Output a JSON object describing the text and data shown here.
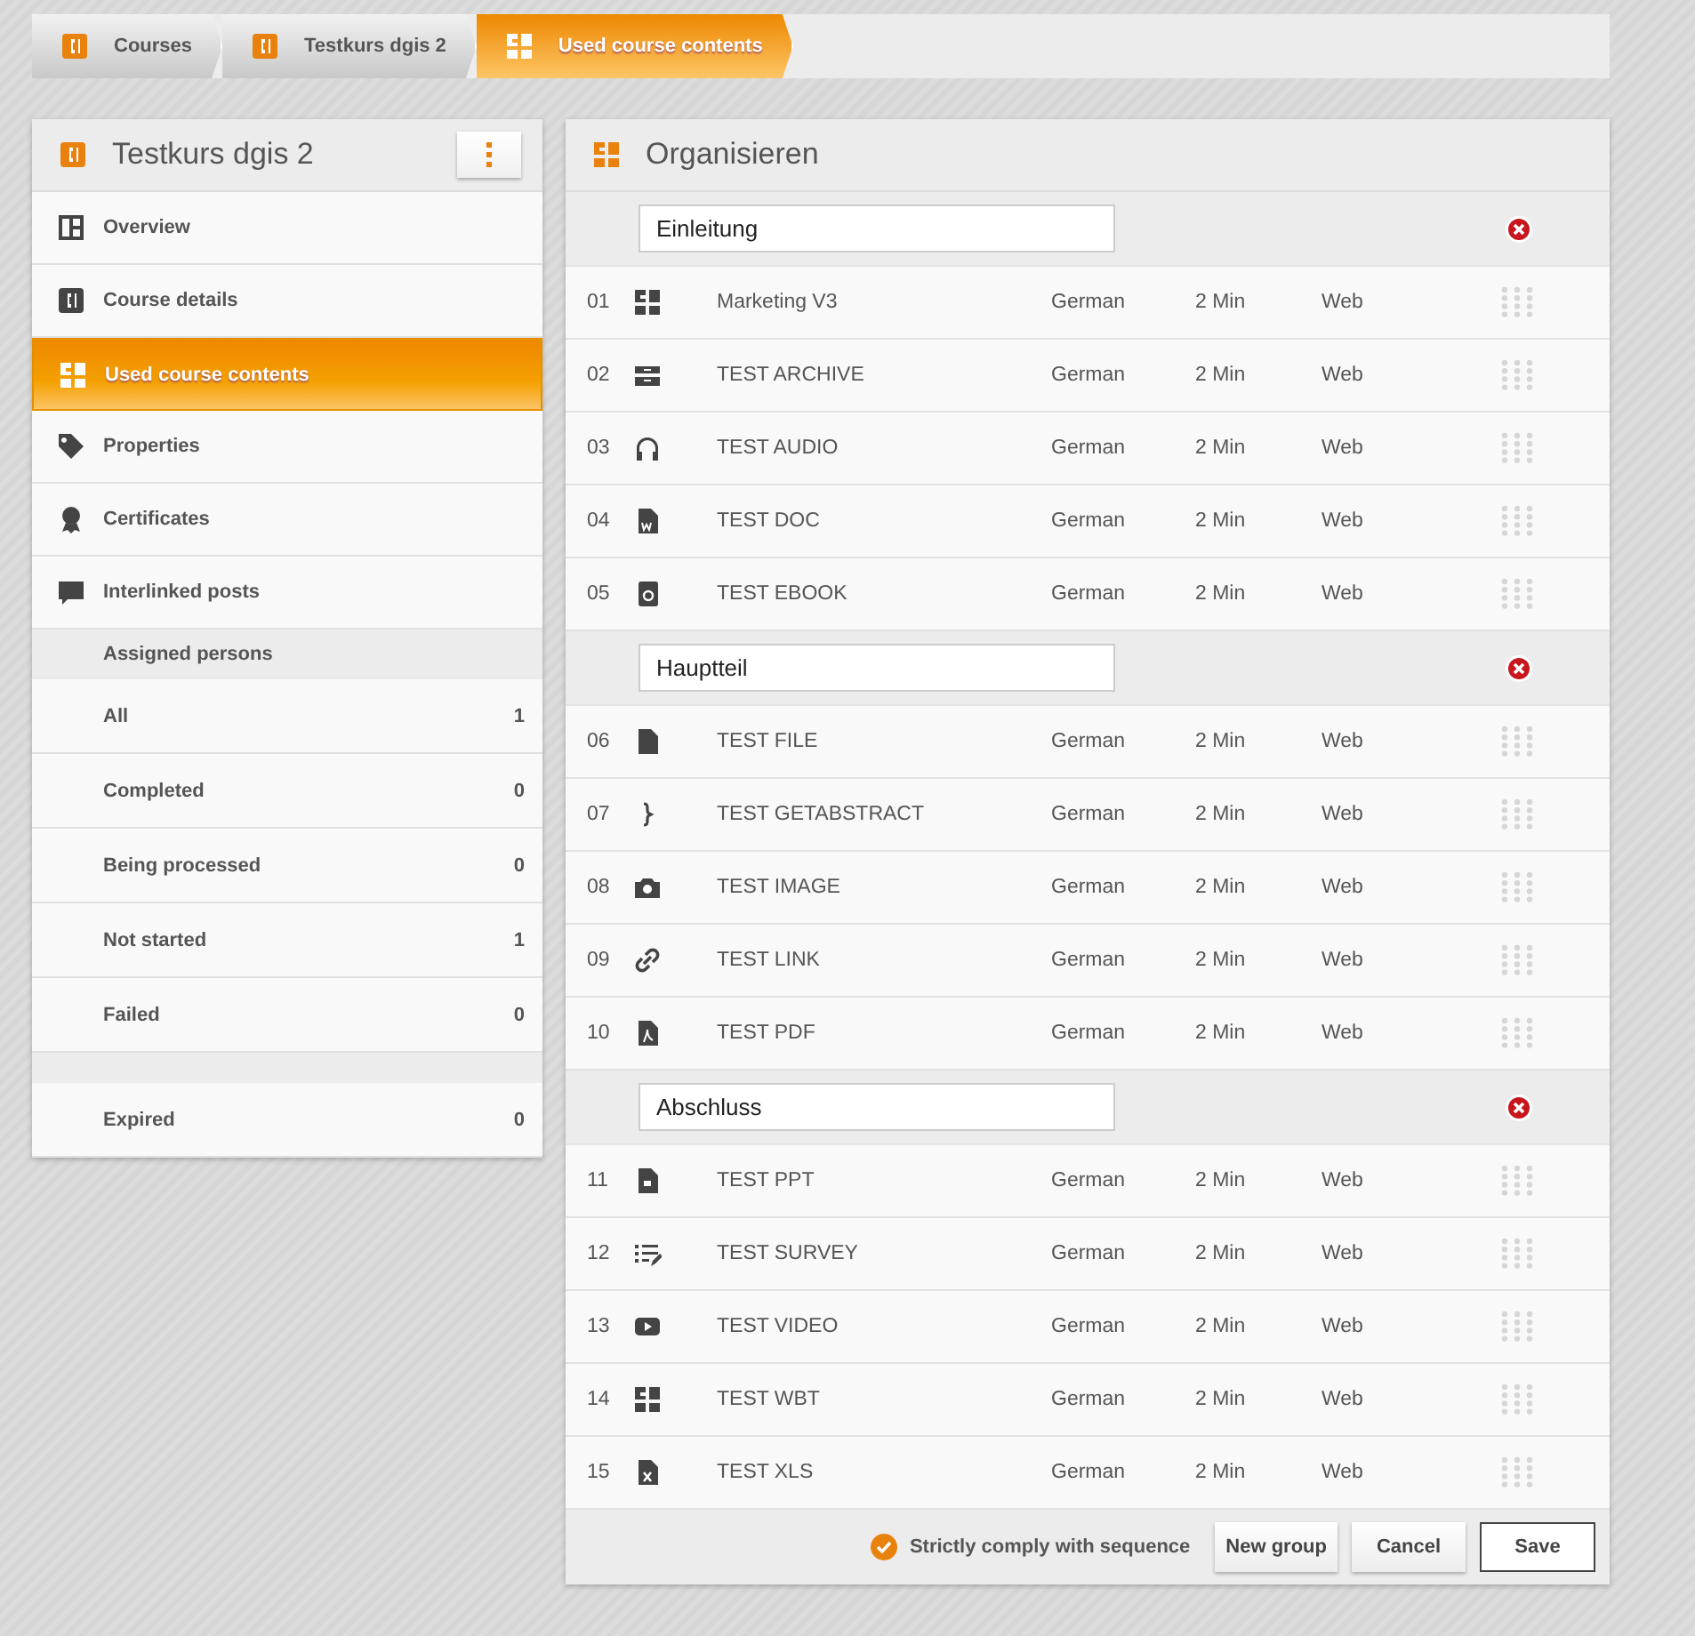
{
  "breadcrumb": [
    {
      "label": "Courses",
      "kind": "course",
      "selected": false
    },
    {
      "label": "Testkurs dgis 2",
      "kind": "course",
      "selected": false
    },
    {
      "label": "Used course contents",
      "kind": "contents",
      "selected": true
    }
  ],
  "sidebar": {
    "title": "Testkurs dgis 2",
    "items": [
      {
        "label": "Overview",
        "kind": "overview",
        "selected": false
      },
      {
        "label": "Course details",
        "kind": "course",
        "selected": false
      },
      {
        "label": "Used course contents",
        "kind": "contents",
        "selected": true
      },
      {
        "label": "Properties",
        "kind": "tag",
        "selected": false
      },
      {
        "label": "Certificates",
        "kind": "certificate",
        "selected": false
      },
      {
        "label": "Interlinked posts",
        "kind": "posts",
        "selected": false
      }
    ],
    "assigned_heading": "Assigned persons",
    "counts": [
      {
        "label": "All",
        "count": "1"
      },
      {
        "label": "Completed",
        "count": "0"
      },
      {
        "label": "Being processed",
        "count": "0"
      },
      {
        "label": "Not started",
        "count": "1"
      },
      {
        "label": "Failed",
        "count": "0"
      }
    ],
    "more_counts": [
      {
        "label": "Expired",
        "count": "0"
      }
    ]
  },
  "content": {
    "title": "Organisieren",
    "groups": [
      {
        "name": "Einleitung",
        "items": [
          {
            "number": "01",
            "kind": "wbt",
            "title": "Marketing V3",
            "language": "German",
            "duration": "2 Min",
            "format": "Web"
          },
          {
            "number": "02",
            "kind": "archive",
            "title": "TEST ARCHIVE",
            "language": "German",
            "duration": "2 Min",
            "format": "Web"
          },
          {
            "number": "03",
            "kind": "audio",
            "title": "TEST AUDIO",
            "language": "German",
            "duration": "2 Min",
            "format": "Web"
          },
          {
            "number": "04",
            "kind": "doc",
            "title": "TEST DOC",
            "language": "German",
            "duration": "2 Min",
            "format": "Web"
          },
          {
            "number": "05",
            "kind": "ebook",
            "title": "TEST EBOOK",
            "language": "German",
            "duration": "2 Min",
            "format": "Web"
          }
        ]
      },
      {
        "name": "Hauptteil",
        "items": [
          {
            "number": "06",
            "kind": "file",
            "title": "TEST FILE",
            "language": "German",
            "duration": "2 Min",
            "format": "Web"
          },
          {
            "number": "07",
            "kind": "getabstract",
            "title": "TEST GETABSTRACT",
            "language": "German",
            "duration": "2 Min",
            "format": "Web"
          },
          {
            "number": "08",
            "kind": "image",
            "title": "TEST IMAGE",
            "language": "German",
            "duration": "2 Min",
            "format": "Web"
          },
          {
            "number": "09",
            "kind": "link",
            "title": "TEST LINK",
            "language": "German",
            "duration": "2 Min",
            "format": "Web"
          },
          {
            "number": "10",
            "kind": "pdf",
            "title": "TEST PDF",
            "language": "German",
            "duration": "2 Min",
            "format": "Web"
          }
        ]
      },
      {
        "name": "Abschluss",
        "items": [
          {
            "number": "11",
            "kind": "ppt",
            "title": "TEST PPT",
            "language": "German",
            "duration": "2 Min",
            "format": "Web"
          },
          {
            "number": "12",
            "kind": "survey",
            "title": "TEST SURVEY",
            "language": "German",
            "duration": "2 Min",
            "format": "Web"
          },
          {
            "number": "13",
            "kind": "video",
            "title": "TEST VIDEO",
            "language": "German",
            "duration": "2 Min",
            "format": "Web"
          },
          {
            "number": "14",
            "kind": "wbt",
            "title": "TEST WBT",
            "language": "German",
            "duration": "2 Min",
            "format": "Web"
          },
          {
            "number": "15",
            "kind": "xls",
            "title": "TEST XLS",
            "language": "German",
            "duration": "2 Min",
            "format": "Web"
          }
        ]
      }
    ],
    "strict": {
      "label": "Strictly comply with sequence",
      "checked": true
    },
    "buttons": [
      {
        "label": "New group",
        "primary": false
      },
      {
        "label": "Cancel",
        "primary": false
      },
      {
        "label": "Save",
        "primary": true
      }
    ]
  }
}
